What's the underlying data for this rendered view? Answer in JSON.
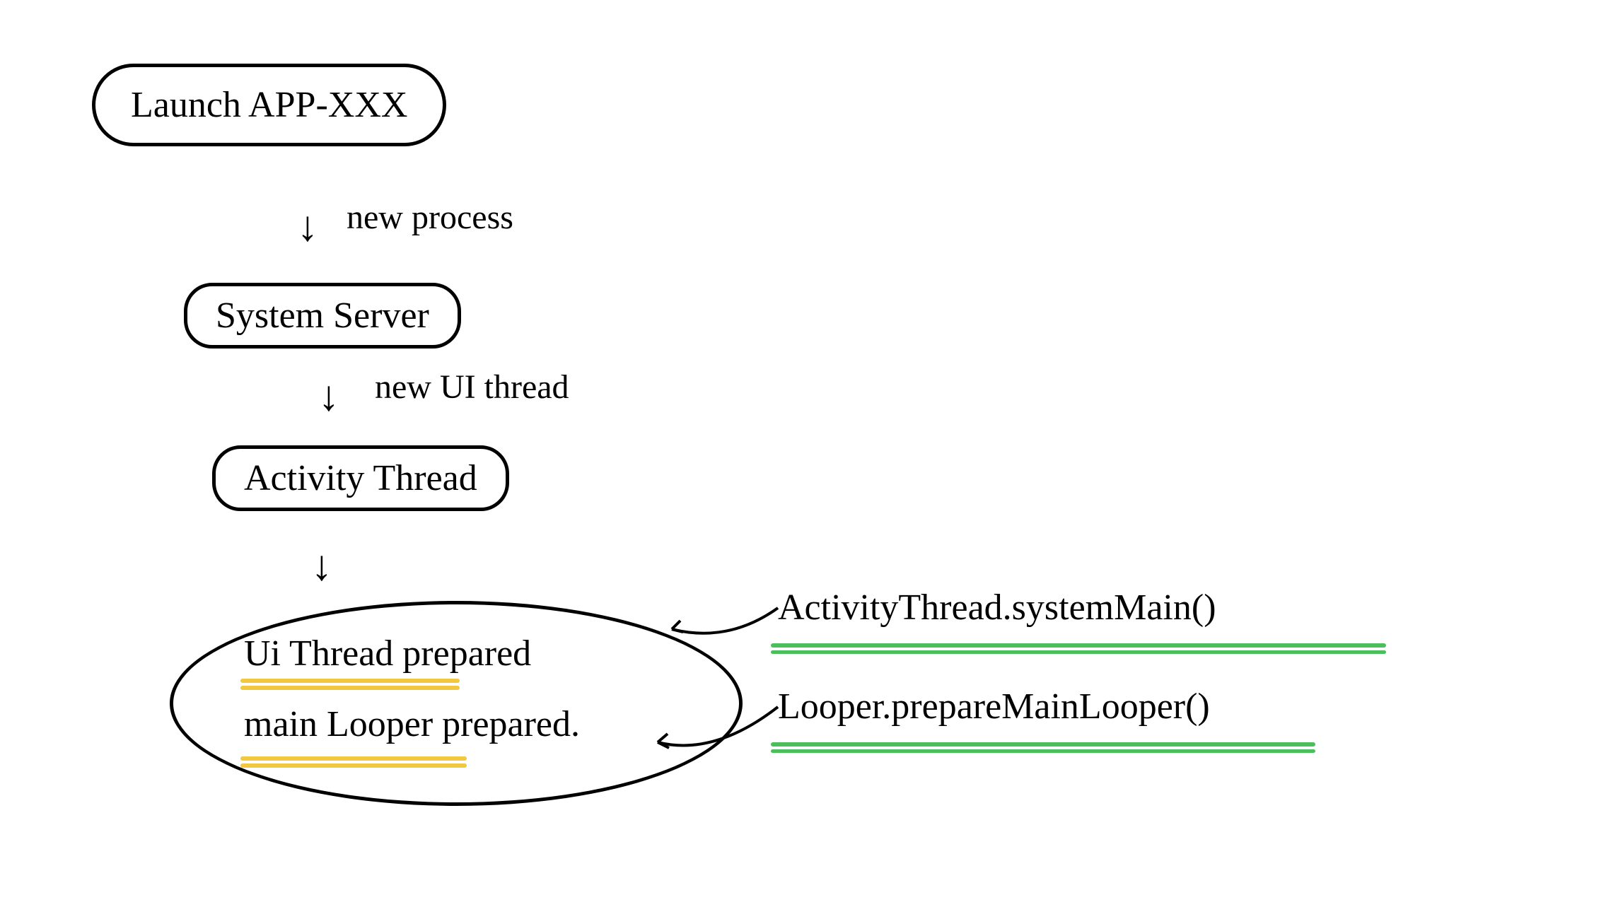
{
  "nodes": {
    "launch_app": "Launch APP-XXX",
    "system_server": "System Server",
    "activity_thread": "Activity Thread",
    "prepared": {
      "line1": "Ui Thread prepared",
      "line2": "main Looper prepared."
    }
  },
  "edges": {
    "new_process": "new process",
    "new_ui_thread": "new UI thread"
  },
  "annotations": {
    "system_main": "ActivityThread.systemMain()",
    "prepare_main_looper": "Looper.prepareMainLooper()"
  },
  "colors": {
    "yellow": "#f2c840",
    "green": "#4bbf5b",
    "ink": "#000000"
  }
}
